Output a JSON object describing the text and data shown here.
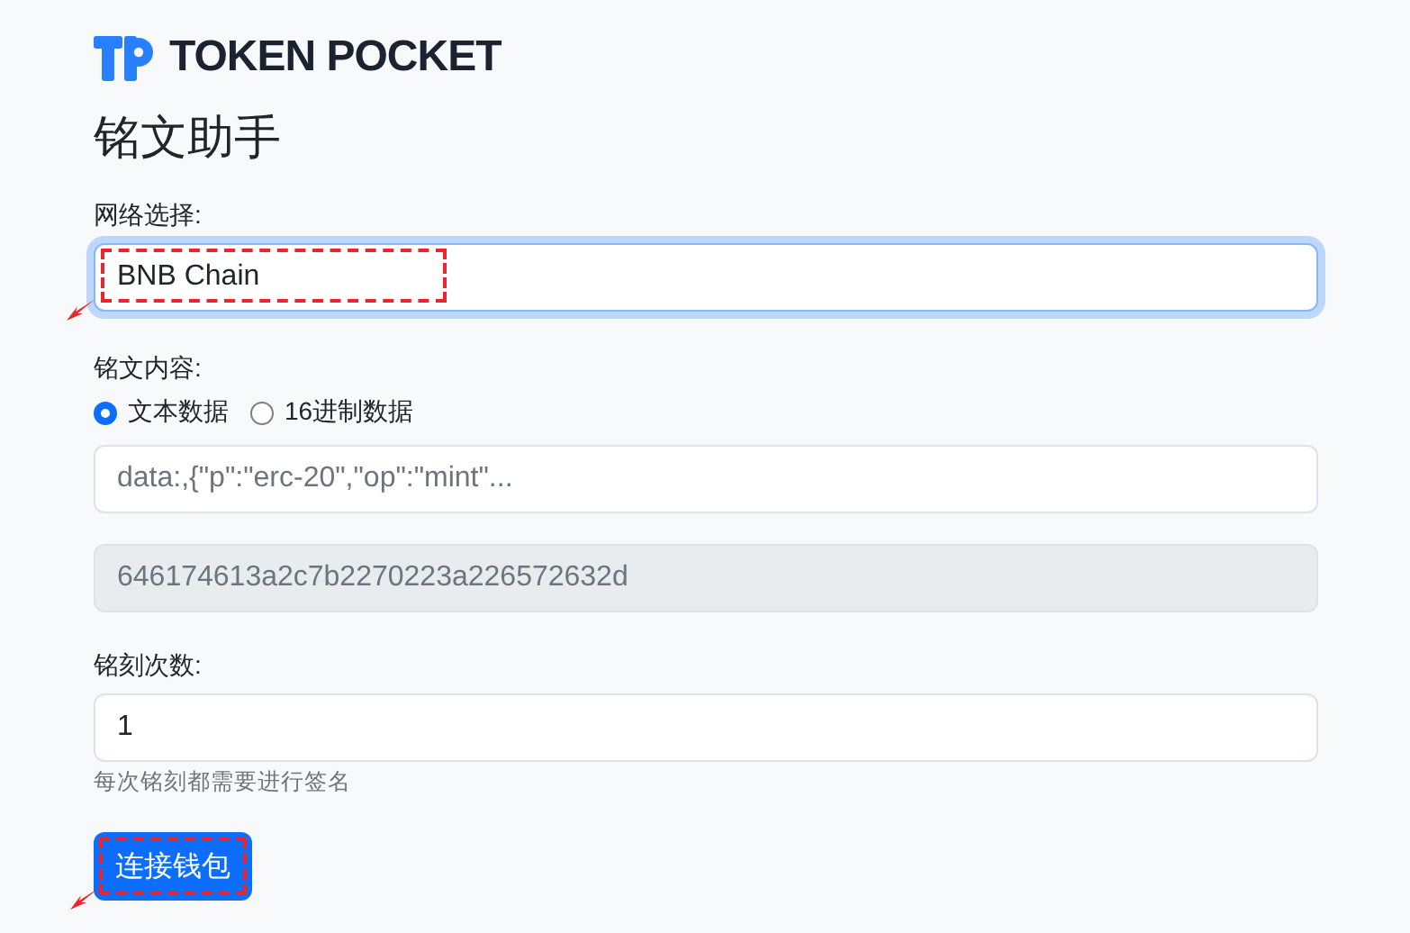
{
  "brand": {
    "name": "TOKEN POCKET"
  },
  "title": "铭文助手",
  "network": {
    "label": "网络选择:",
    "value": "BNB Chain",
    "focused": true,
    "highlighted": true
  },
  "content": {
    "label": "铭文内容:",
    "options": [
      {
        "label": "文本数据",
        "selected": true
      },
      {
        "label": "16进制数据",
        "selected": false
      }
    ],
    "text_placeholder": "data:,{\"p\":\"erc-20\",\"op\":\"mint\"...",
    "hex_value": "646174613a2c7b2270223a226572632d",
    "hex_disabled": true
  },
  "count": {
    "label": "铭刻次数:",
    "value": "1",
    "help": "每次铭刻都需要进行签名"
  },
  "button": {
    "label": "连接钱包",
    "highlighted": true
  }
}
